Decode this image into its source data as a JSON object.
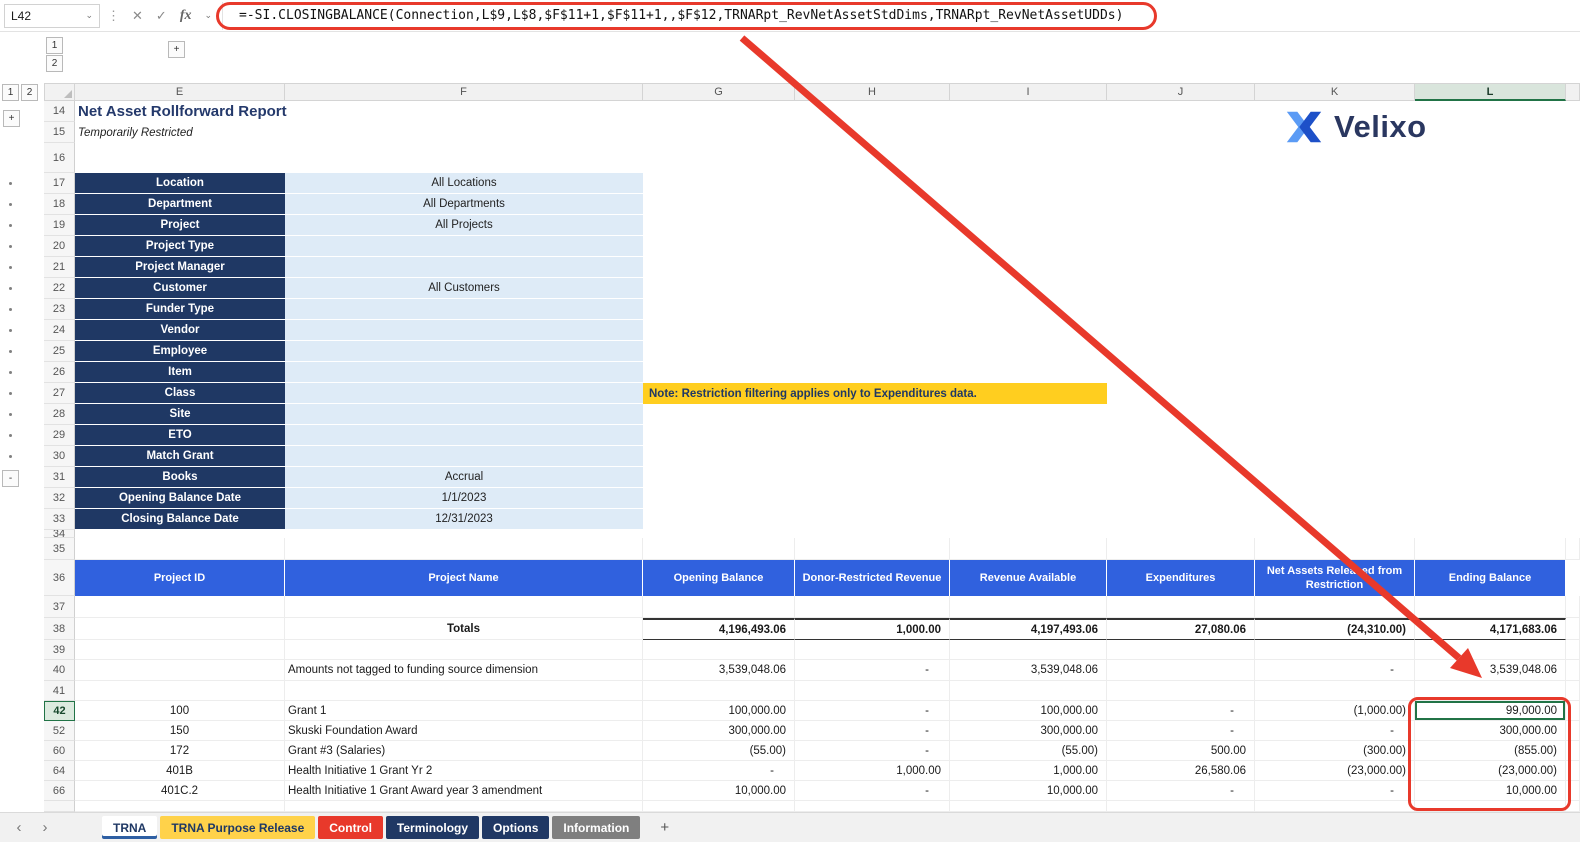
{
  "formula_bar": {
    "name_box": "L42",
    "formula": "=-SI.CLOSINGBALANCE(Connection,L$9,L$8,$F$11+1,$F$11+1,,$F$12,TRNARpt_RevNetAssetStdDims,TRNARpt_RevNetAssetUDDs)"
  },
  "icons": {
    "name_box_dropdown": "⌄",
    "drag_dots": "⋮",
    "cancel": "✕",
    "enter": "✓",
    "fx": "fx",
    "fx_dropdown": "⌄",
    "nav_left": "‹",
    "nav_right": "›",
    "add_sheet": "+"
  },
  "outline": {
    "row_levels": [
      "1",
      "2"
    ],
    "col_levels": [
      "1",
      "2"
    ],
    "collapse": "-",
    "expand": "+"
  },
  "columns": [
    "E",
    "F",
    "G",
    "H",
    "I",
    "J",
    "K",
    "L"
  ],
  "row_numbers": [
    "14",
    "15",
    "16",
    "17",
    "18",
    "19",
    "20",
    "21",
    "22",
    "23",
    "24",
    "25",
    "26",
    "27",
    "28",
    "29",
    "30",
    "31",
    "32",
    "33",
    "34",
    "35",
    "36",
    "37",
    "38",
    "39",
    "40",
    "41",
    "42",
    "52",
    "60",
    "64",
    "66"
  ],
  "report": {
    "title": "Net Asset Rollforward Report",
    "subtitle": "Temporarily Restricted",
    "filters": [
      {
        "label": "Location",
        "value": "All Locations"
      },
      {
        "label": "Department",
        "value": "All Departments"
      },
      {
        "label": "Project",
        "value": "All Projects"
      },
      {
        "label": "Project Type",
        "value": ""
      },
      {
        "label": "Project Manager",
        "value": ""
      },
      {
        "label": "Customer",
        "value": "All Customers"
      },
      {
        "label": "Funder Type",
        "value": ""
      },
      {
        "label": "Vendor",
        "value": ""
      },
      {
        "label": "Employee",
        "value": ""
      },
      {
        "label": "Item",
        "value": ""
      },
      {
        "label": "Class",
        "value": ""
      },
      {
        "label": "Site",
        "value": ""
      },
      {
        "label": "ETO",
        "value": ""
      },
      {
        "label": "Match Grant",
        "value": ""
      },
      {
        "label": "Books",
        "value": "Accrual"
      },
      {
        "label": "Opening Balance Date",
        "value": "1/1/2023"
      },
      {
        "label": "Closing Balance Date",
        "value": "12/31/2023"
      }
    ],
    "note": "Note: Restriction filtering applies only to Expenditures data.",
    "logo_text": "Velixo"
  },
  "table": {
    "headers": [
      "Project ID",
      "Project Name",
      "Opening Balance",
      "Donor-Restricted Revenue",
      "Revenue Available",
      "Expenditures",
      "Net Assets Released from Restriction",
      "Ending Balance"
    ],
    "totals_label": "Totals",
    "totals": [
      "4,196,493.06",
      "1,000.00",
      "4,197,493.06",
      "27,080.06",
      "(24,310.00)",
      "4,171,683.06"
    ],
    "untagged_label": "Amounts not tagged to funding source dimension",
    "untagged": [
      "3,539,048.06",
      "-",
      "3,539,048.06",
      "",
      "-",
      "3,539,048.06"
    ],
    "rows": [
      {
        "row": "42",
        "id": "100",
        "name": "Grant 1",
        "values": [
          "100,000.00",
          "-",
          "100,000.00",
          "-",
          "(1,000.00)",
          "99,000.00"
        ]
      },
      {
        "row": "52",
        "id": "150",
        "name": "Skuski Foundation Award",
        "values": [
          "300,000.00",
          "-",
          "300,000.00",
          "-",
          "-",
          "300,000.00"
        ]
      },
      {
        "row": "60",
        "id": "172",
        "name": "Grant #3 (Salaries)",
        "values": [
          "(55.00)",
          "-",
          "(55.00)",
          "500.00",
          "(300.00)",
          "(855.00)"
        ]
      },
      {
        "row": "64",
        "id": "401B",
        "name": "Health Initiative 1 Grant Yr 2",
        "values": [
          "-",
          "1,000.00",
          "1,000.00",
          "26,580.06",
          "(23,000.00)",
          "(23,000.00)"
        ]
      },
      {
        "row": "66",
        "id": "401C.2",
        "name": "Health Initiative 1 Grant Award year 3 amendment",
        "values": [
          "10,000.00",
          "-",
          "10,000.00",
          "-",
          "-",
          "10,000.00"
        ]
      }
    ]
  },
  "sheet_tabs": [
    {
      "label": "TRNA",
      "style": "active"
    },
    {
      "label": "TRNA Purpose Release",
      "style": "gold"
    },
    {
      "label": "Control",
      "style": "red"
    },
    {
      "label": "Terminology",
      "style": "navy"
    },
    {
      "label": "Options",
      "style": "navy"
    },
    {
      "label": "Information",
      "style": "gray"
    }
  ],
  "colors": {
    "navy": "#1F3864",
    "filter_value_bg": "#DEEBF7",
    "table_header_bg": "#3061DE",
    "note_bg": "#FFCE1F",
    "annotation_red": "#E8392B",
    "selection_green": "#217346",
    "tab_gold": "#FFD24A",
    "tab_red": "#E8392B",
    "tab_navy": "#203864",
    "tab_gray": "#7F7F7F"
  }
}
